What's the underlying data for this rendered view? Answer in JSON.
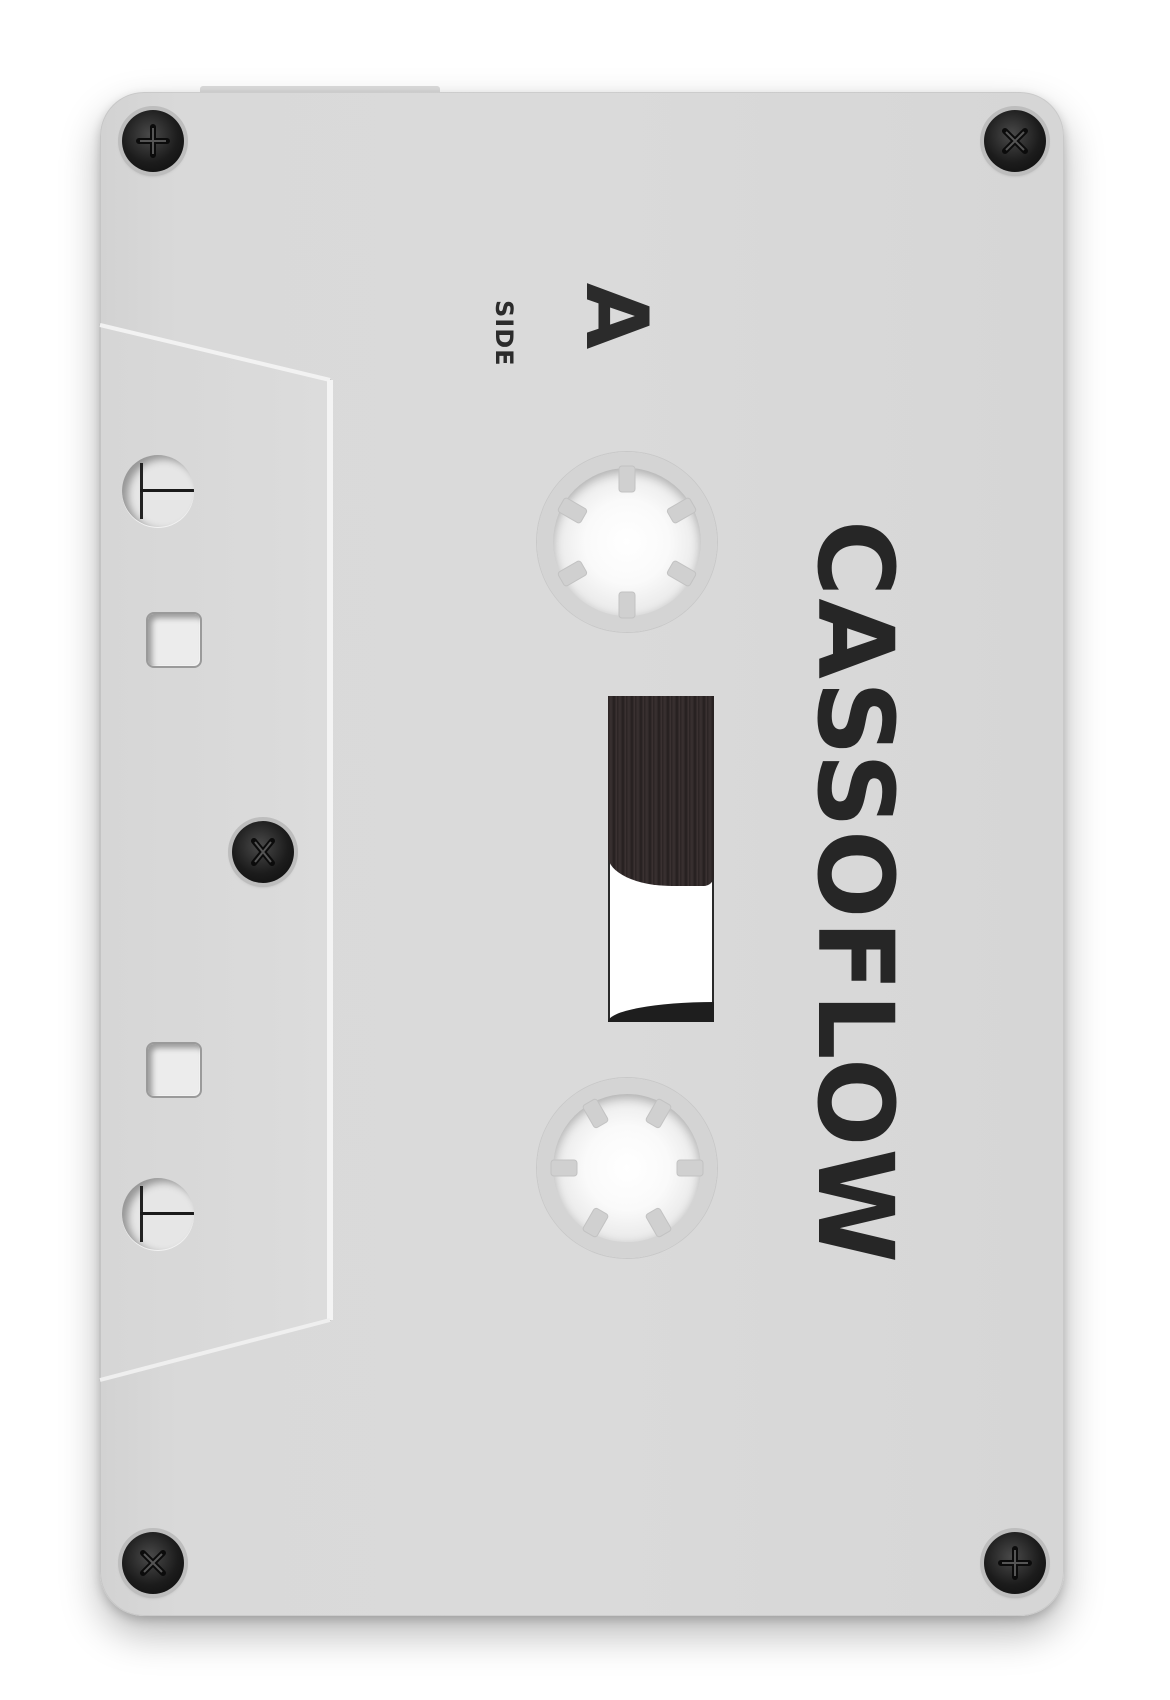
{
  "cassette": {
    "side_word": "SIDE",
    "side_letter": "A",
    "brand": "CASSOFLOW"
  },
  "colors": {
    "shell": "#d9d9d9",
    "screw": "#1c1c1c",
    "text": "#262626",
    "tape": "#2f2828"
  },
  "icons": {
    "screws": [
      "screw-icon",
      "screw-icon",
      "screw-icon",
      "screw-icon",
      "screw-icon"
    ]
  }
}
